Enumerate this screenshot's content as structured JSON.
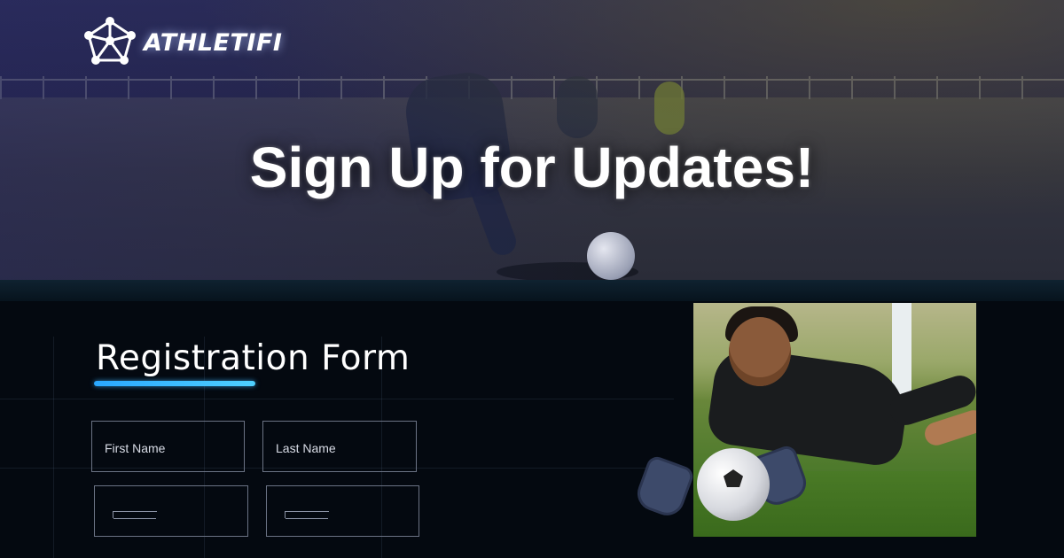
{
  "brand": {
    "logo_text": "ATHLETIFI",
    "logo_icon": "network-node-icon"
  },
  "hero": {
    "headline": "Sign Up for Updates!"
  },
  "form": {
    "title": "Registration Form",
    "fields": [
      {
        "label": "First Name"
      },
      {
        "label": "Last Name"
      },
      {
        "label": ""
      },
      {
        "label": ""
      }
    ]
  },
  "colors": {
    "accent": "#2aa8ff",
    "background": "#040910"
  }
}
